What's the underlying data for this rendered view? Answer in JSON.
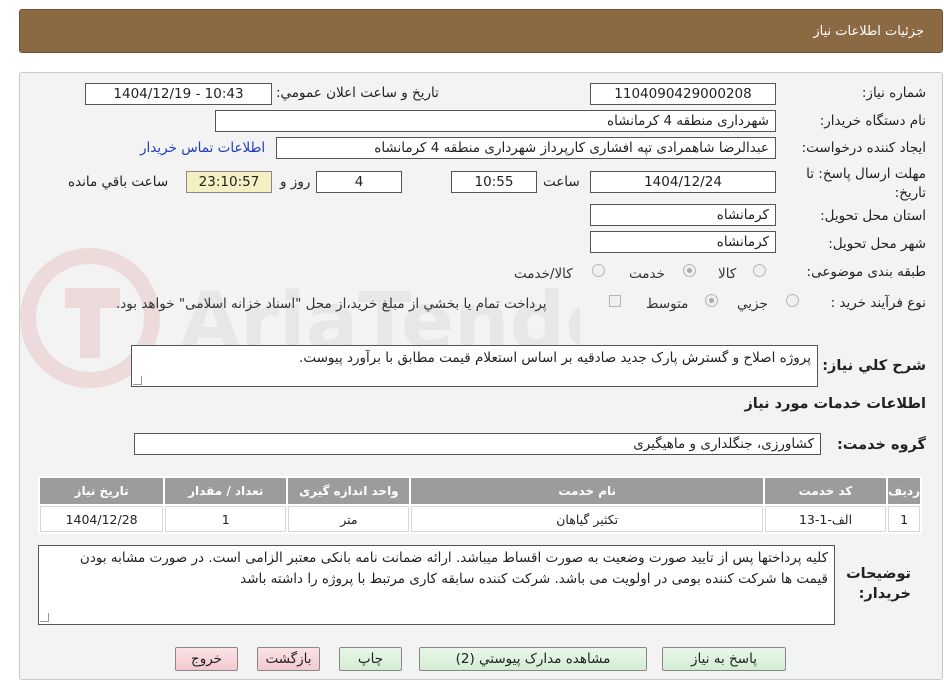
{
  "header": {
    "title": "جزئیات اطلاعات نیاز"
  },
  "form": {
    "need_number": {
      "label": "شماره نیاز:",
      "value": "1104090429000208"
    },
    "announce_datetime": {
      "label": "تاریخ و ساعت اعلان عمومي:",
      "value": "1404/12/19 - 10:43"
    },
    "buyer_org": {
      "label": "نام دستگاه خريدار:",
      "value": "شهرداری منطقه 4 کرمانشاه"
    },
    "requester": {
      "label": "ايجاد کننده درخواست:",
      "value": "عبدالرضا شاهمرادی تپه افشاری کارپرداز شهرداری منطقه 4 کرمانشاه"
    },
    "buyer_contact_link": "اطلاعات تماس خريدار",
    "deadline": {
      "label": "مهلت ارسال پاسخ: تا",
      "label2": "تاريخ:",
      "date": "1404/12/24",
      "time_label": "ساعت",
      "time": "10:55",
      "days": "4",
      "days_label": "روز و",
      "remaining": "23:10:57",
      "remaining_label": "ساعت باقي مانده"
    },
    "province": {
      "label": "استان محل تحويل:",
      "value": "کرمانشاه"
    },
    "city": {
      "label": "شهر محل تحويل:",
      "value": "کرمانشاه"
    },
    "category": {
      "label": "طبقه بندی موضوعی:",
      "options": [
        "کالا",
        "خدمت",
        "کالا/خدمت"
      ],
      "selected": "خدمت"
    },
    "purchase_type": {
      "label": "نوع فرآیند خرید :",
      "options": [
        "جزيي",
        "متوسط"
      ],
      "selected": "متوسط",
      "note": "پرداخت تمام يا بخشي از مبلغ خريد،از محل \"اسناد خزانه اسلامی\" خواهد بود."
    },
    "description": {
      "label": "شرح کلي نياز:",
      "value": "پروژه اصلاح و گسترش پارک جدید صادقیه بر اساس استعلام قیمت مطابق با برآورد پیوست."
    }
  },
  "services": {
    "section_title": "اطلاعات خدمات مورد نياز",
    "group_label": "گروه خدمت:",
    "group_value": "کشاورزی، جنگلداری و ماهیگیری",
    "table": {
      "headers": [
        "رديف",
        "کد خدمت",
        "نام خدمت",
        "واحد اندازه گيری",
        "تعداد / مقدار",
        "تاريخ نياز"
      ],
      "rows": [
        [
          "1",
          "الف-1-13",
          "تکثیر گیاهان",
          "متر",
          "1",
          "1404/12/28"
        ]
      ]
    }
  },
  "buyer_notes": {
    "label1": "توضيحات",
    "label2": "خريدار:",
    "value": "کلیه پرداختها پس از تایید صورت وضعیت به صورت اقساط میباشد. ارائه ضمانت نامه بانکی معتبر الزامی است. در صورت مشابه بودن قیمت ها شرکت کننده بومی در اولویت می باشد. شرکت کننده سابقه کاری مرتبط با پروژه را داشته باشد"
  },
  "buttons": {
    "reply": "پاسخ به نياز",
    "attachments": "مشاهده مدارک پيوستي (2)",
    "print": "چاپ",
    "back": "بازگشت",
    "exit": "خروج"
  },
  "colors": {
    "header_bg": "#8b6a43",
    "table_header_bg": "#9c9c9c",
    "button_green": "#d2ecd2",
    "button_pink": "#f3c9ce",
    "remaining_bg": "#f5f0c4"
  }
}
